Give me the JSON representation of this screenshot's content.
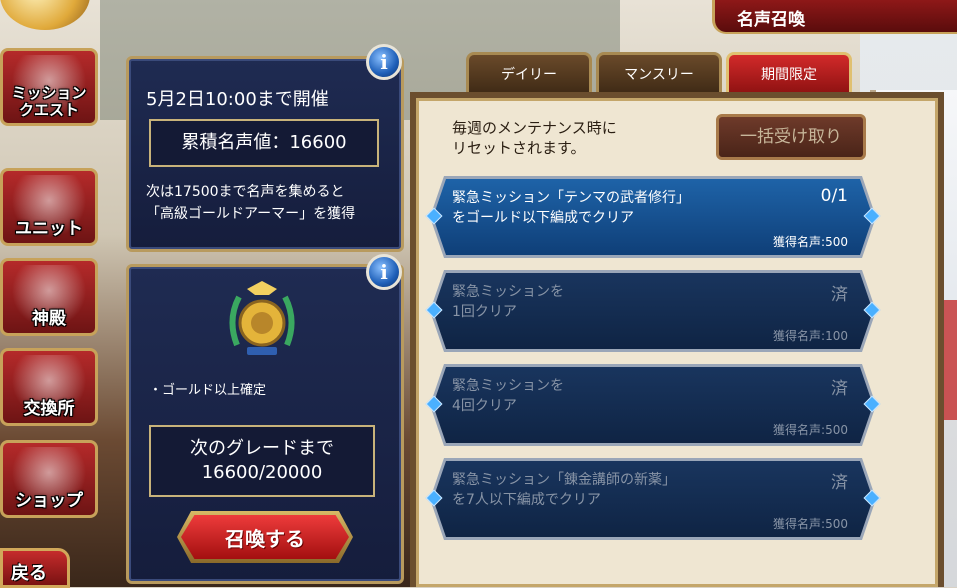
{
  "header": {
    "title": "名声召喚"
  },
  "nav": {
    "items": [
      {
        "label": "ミッション\nクエスト"
      },
      {
        "label": "ユニット"
      },
      {
        "label": "神殿"
      },
      {
        "label": "交換所"
      },
      {
        "label": "ショップ"
      }
    ],
    "back_label": "戻る"
  },
  "event_panel": {
    "date": "5月2日10:00まで開催",
    "points": "累積名声値：16600",
    "next_line1": "次は17500まで名声を集めると",
    "next_line2": "「高級ゴールドアーマー」を獲得"
  },
  "summon_panel": {
    "bullet": "・ゴールド以上確定",
    "grade_line1": "次のグレードまで",
    "grade_line2": "16600/20000",
    "summon_label": "召喚する"
  },
  "tabs": [
    {
      "label": "デイリー",
      "active": false
    },
    {
      "label": "マンスリー",
      "active": false
    },
    {
      "label": "期間限定",
      "active": true
    }
  ],
  "board": {
    "notice_line1": "毎週のメンテナンス時に",
    "notice_line2": "リセットされます。",
    "bulk_label": "一括受け取り",
    "missions": [
      {
        "text": "緊急ミッション「テンマの武者修行」\nをゴールド以下編成でクリア",
        "status": "0/1",
        "reward": "獲得名声:500",
        "state": "active"
      },
      {
        "text": "緊急ミッションを\n1回クリア",
        "status": "済",
        "reward": "獲得名声:100",
        "state": "done"
      },
      {
        "text": "緊急ミッションを\n4回クリア",
        "status": "済",
        "reward": "獲得名声:500",
        "state": "done"
      },
      {
        "text": "緊急ミッション「錬金講師の新薬」\nを7人以下編成でクリア",
        "status": "済",
        "reward": "獲得名声:500",
        "state": "done"
      }
    ]
  },
  "icons": {
    "info": "info-icon",
    "emblem": "gold-trophy-emblem-icon"
  }
}
